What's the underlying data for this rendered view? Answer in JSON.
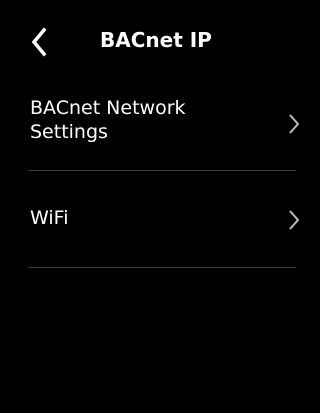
{
  "header": {
    "title": "BACnet IP",
    "back_icon": "chevron-left-icon"
  },
  "menu": {
    "items": [
      {
        "label_line1": "BACnet Network",
        "label_line2": "Settings",
        "icon": "chevron-right-icon"
      },
      {
        "label": "WiFi",
        "icon": "chevron-right-icon"
      }
    ]
  },
  "colors": {
    "background": "#000000",
    "text": "#ffffff",
    "chevron": "#bdbdbd",
    "divider": "#3c3c3c"
  }
}
